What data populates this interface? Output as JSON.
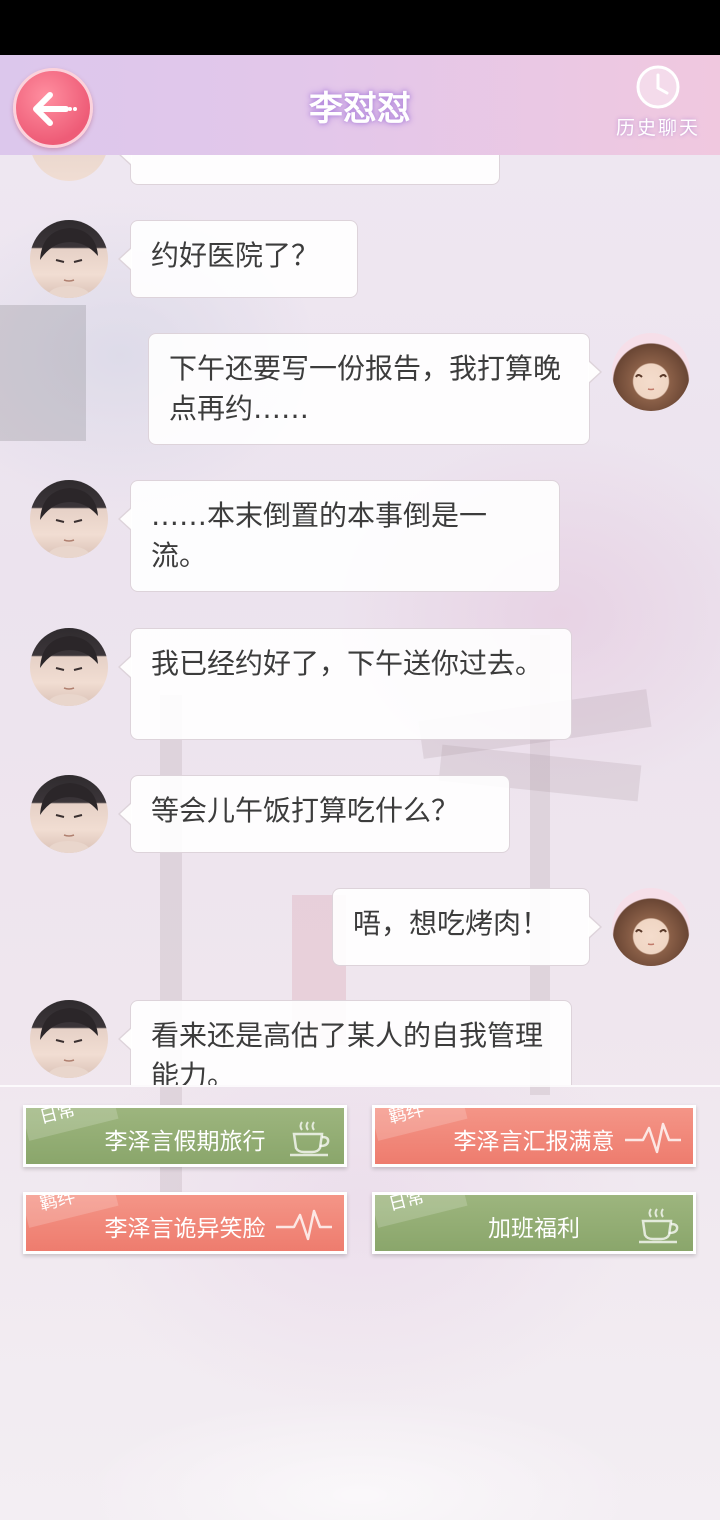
{
  "header": {
    "title": "李怼怼",
    "history_label": "历史聊天"
  },
  "messages": [
    {
      "side": "left",
      "text": "约好医院了？"
    },
    {
      "side": "right",
      "text": "下午还要写一份报告，我打算晚点再约……"
    },
    {
      "side": "left",
      "text": "……本末倒置的本事倒是一流。"
    },
    {
      "side": "left",
      "text": "我已经约好了，下午送你过去。"
    },
    {
      "side": "left",
      "text": "等会儿午饭打算吃什么？"
    },
    {
      "side": "right",
      "text": "唔，想吃烤肉！"
    },
    {
      "side": "left",
      "text": "看来还是高估了某人的自我管理能力。"
    }
  ],
  "choices": [
    {
      "tag": "日常",
      "label": "李泽言假期旅行",
      "color": "green",
      "icon": "coffee-cup-icon"
    },
    {
      "tag": "羁绊",
      "label": "李泽言汇报满意",
      "color": "red",
      "icon": "heartbeat-icon"
    },
    {
      "tag": "羁绊",
      "label": "李泽言诡异笑脸",
      "color": "red",
      "icon": "heartbeat-icon"
    },
    {
      "tag": "日常",
      "label": "加班福利",
      "color": "green",
      "icon": "coffee-cup-icon"
    }
  ],
  "colors": {
    "green_choice": "#8fa970",
    "red_choice": "#f08373",
    "back_button": "#ee5c77",
    "header_left": "#dcc7ec",
    "header_right": "#f0c8df"
  }
}
